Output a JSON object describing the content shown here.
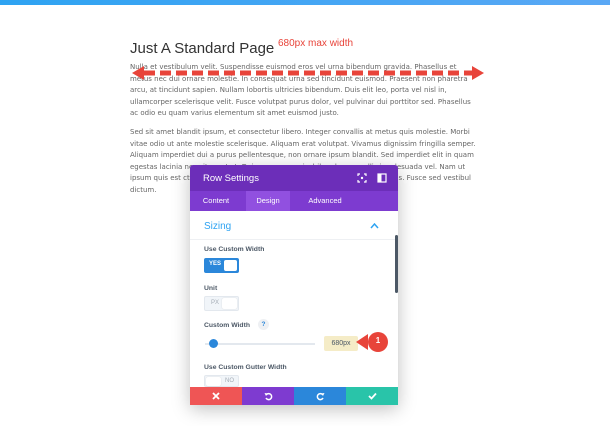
{
  "page": {
    "title": "Just A Standard Page",
    "annotation": "680px max width",
    "paragraph1": "Nulla et vestibulum velit. Suspendisse euismod eros vel urna bibendum gravida. Phasellus et metus nec dui ornare molestie. In consequat urna sed tincidunt euismod. Praesent non pharetra arcu, at tincidunt sapien. Nullam lobortis ultricies bibendum. Duis elit leo, porta vel nisl in, ullamcorper scelerisque velit. Fusce volutpat purus dolor, vel pulvinar dui porttitor sed. Phasellus ac odio eu quam varius elementum sit amet euismod justo.",
    "paragraph2": "Sed sit amet blandit ipsum, et consectetur libero. Integer convallis at metus quis molestie. Morbi vitae odio ut ante molestie scelerisque. Aliquam erat volutpat. Vivamus dignissim fringilla semper. Aliquam imperdiet dui a purus pellentesque, non ornare ipsum blandit. Sed imperdiet elit in quam egestas lacinia nec sit amet at. Duis massa mauris, bibendum a molli si malesuada vel. Nam ut ipsum quis est ctetur adipiscing elit. Maecenas nunc fe dictum dolor at varius. Fusce sed vestibul dictum."
  },
  "modal": {
    "title": "Row Settings",
    "tabs": [
      {
        "label": "Content"
      },
      {
        "label": "Design"
      },
      {
        "label": "Advanced"
      }
    ],
    "active_tab": "Design",
    "section_title": "Sizing",
    "fields": {
      "use_custom_width": {
        "label": "Use Custom Width",
        "toggle": "YES"
      },
      "unit": {
        "label": "Unit",
        "toggle": "PX"
      },
      "custom_width": {
        "label": "Custom Width",
        "help": "?",
        "value": "680px",
        "slider_fraction": 0.08
      },
      "use_custom_gutter_width": {
        "label": "Use Custom Gutter Width",
        "toggle": "NO"
      }
    },
    "badge": "1",
    "footer": [
      {
        "icon": "close-icon",
        "color": "#ef5555"
      },
      {
        "icon": "undo-icon",
        "color": "#7e3bd0"
      },
      {
        "icon": "redo-icon",
        "color": "#2b87da"
      },
      {
        "icon": "check-icon",
        "color": "#29c4a9"
      }
    ]
  },
  "colors": {
    "accent_red": "#e8443a",
    "header_purple": "#6c2eb9",
    "tab_purple": "#7d3bd0",
    "blue": "#2b87da"
  }
}
